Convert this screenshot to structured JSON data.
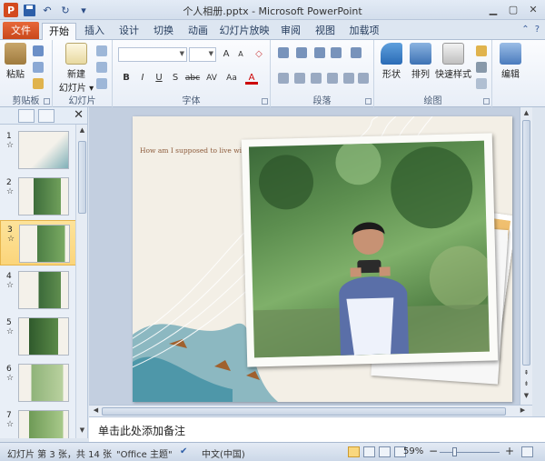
{
  "window": {
    "title": "个人相册.pptx - Microsoft PowerPoint",
    "app_icon": "P",
    "min": "▭",
    "restore": "▢",
    "close": "✕"
  },
  "qat": {
    "undo": "↶",
    "redo": "↻",
    "more": "▾"
  },
  "tabs": {
    "file": "文件",
    "items": [
      "开始",
      "插入",
      "设计",
      "切换",
      "动画",
      "幻灯片放映",
      "审阅",
      "视图",
      "加载项"
    ],
    "active": "开始"
  },
  "ribbon": {
    "clipboard": {
      "label": "剪贴板",
      "paste": "粘贴"
    },
    "slides": {
      "label": "幻灯片",
      "new_slide_1": "新建",
      "new_slide_2": "幻灯片 ▾"
    },
    "font": {
      "label": "字体",
      "buttons": [
        "B",
        "I",
        "U",
        "S",
        "abc",
        "AV",
        "Aa",
        "A"
      ],
      "grow": "A",
      "shrink": "A"
    },
    "paragraph": {
      "label": "段落"
    },
    "drawing": {
      "label": "绘图",
      "shape": "形状",
      "arrange": "排列",
      "quick_styles": "快速样式"
    },
    "editing": {
      "label": "编辑"
    }
  },
  "slides_pane": {
    "close": "✕",
    "thumbnails": [
      {
        "num": "1",
        "anim": "☆"
      },
      {
        "num": "2",
        "anim": "☆"
      },
      {
        "num": "3",
        "anim": "☆"
      },
      {
        "num": "4",
        "anim": "☆"
      },
      {
        "num": "5",
        "anim": "☆"
      },
      {
        "num": "6",
        "anim": "☆"
      },
      {
        "num": "7",
        "anim": "☆"
      }
    ],
    "selected": 3
  },
  "slide": {
    "text": "How am I supposed to live without You"
  },
  "notes": {
    "placeholder": "单击此处添加备注"
  },
  "status": {
    "slide_info": "幻灯片 第 3 张，共 14 张",
    "theme": "\"Office 主题\"",
    "language": "中文(中国)",
    "zoom": "59%",
    "zoom_out": "−",
    "zoom_in": "+"
  }
}
